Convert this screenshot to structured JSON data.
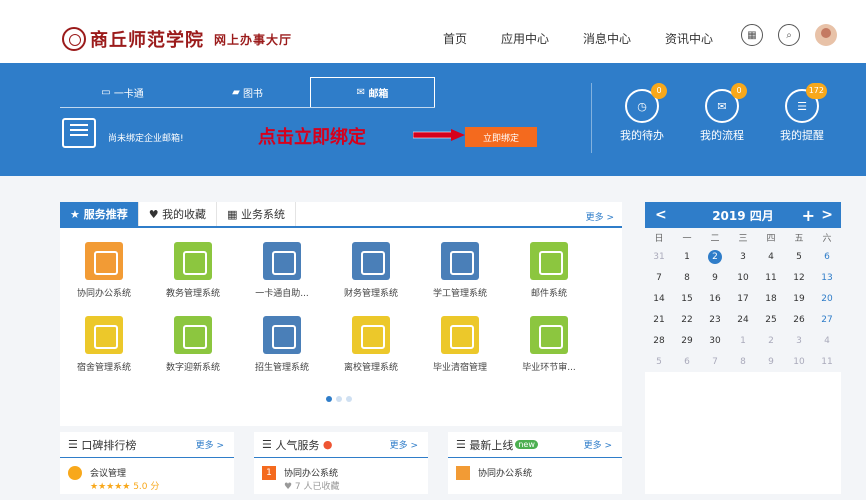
{
  "header": {
    "logo_name": "商丘师范学院",
    "logo_sub": "网上办事大厅",
    "nav": [
      "首页",
      "应用中心",
      "消息中心",
      "资讯中心"
    ]
  },
  "banner": {
    "tabs": [
      "一卡通",
      "图书",
      "邮箱"
    ],
    "active_tab": 2,
    "notice": "尚未绑定企业邮箱!",
    "annotation": "点击立即绑定",
    "bind_button": "立即绑定",
    "quick_actions": [
      {
        "label": "我的待办",
        "badge": "0",
        "icon": "clock-icon"
      },
      {
        "label": "我的流程",
        "badge": "0",
        "icon": "mail-icon"
      },
      {
        "label": "我的提醒",
        "badge": "172",
        "icon": "chat-icon"
      }
    ]
  },
  "services": {
    "tabs": [
      "服务推荐",
      "我的收藏",
      "业务系统"
    ],
    "more": "更多 >",
    "apps": [
      {
        "label": "协同办公系统",
        "color": "#f29b35"
      },
      {
        "label": "教务管理系统",
        "color": "#8cc63f"
      },
      {
        "label": "一卡通自助...",
        "color": "#4a7fb8"
      },
      {
        "label": "财务管理系统",
        "color": "#4a7fb8"
      },
      {
        "label": "学工管理系统",
        "color": "#4a7fb8"
      },
      {
        "label": "邮件系统",
        "color": "#8cc63f"
      },
      {
        "label": "宿舍管理系统",
        "color": "#ecc82a"
      },
      {
        "label": "数字迎新系统",
        "color": "#8cc63f"
      },
      {
        "label": "招生管理系统",
        "color": "#4a7fb8"
      },
      {
        "label": "离校管理系统",
        "color": "#ecc82a"
      },
      {
        "label": "毕业清宿管理",
        "color": "#ecc82a"
      },
      {
        "label": "毕业环节审...",
        "color": "#8cc63f"
      }
    ]
  },
  "cards": [
    {
      "title": "口碑排行榜",
      "more": "更多 >",
      "item": "会议管理",
      "meta": "★★★★★ 5.0 分"
    },
    {
      "title": "人气服务",
      "more": "更多 >",
      "item": "协同办公系统",
      "meta": "♥ 7 人已收藏",
      "rank": "1"
    },
    {
      "title": "最新上线",
      "badge": "new",
      "more": "更多 >",
      "item": "协同办公系统"
    }
  ],
  "calendar": {
    "title": "2019 四月",
    "weekdays": [
      "日",
      "一",
      "二",
      "三",
      "四",
      "五",
      "六"
    ],
    "rows": [
      [
        "31",
        "1",
        "2",
        "3",
        "4",
        "5",
        "6"
      ],
      [
        "7",
        "8",
        "9",
        "10",
        "11",
        "12",
        "13"
      ],
      [
        "14",
        "15",
        "16",
        "17",
        "18",
        "19",
        "20"
      ],
      [
        "21",
        "22",
        "23",
        "24",
        "25",
        "26",
        "27"
      ],
      [
        "28",
        "29",
        "30",
        "1",
        "2",
        "3",
        "4"
      ],
      [
        "5",
        "6",
        "7",
        "8",
        "9",
        "10",
        "11"
      ]
    ],
    "today": "2"
  }
}
